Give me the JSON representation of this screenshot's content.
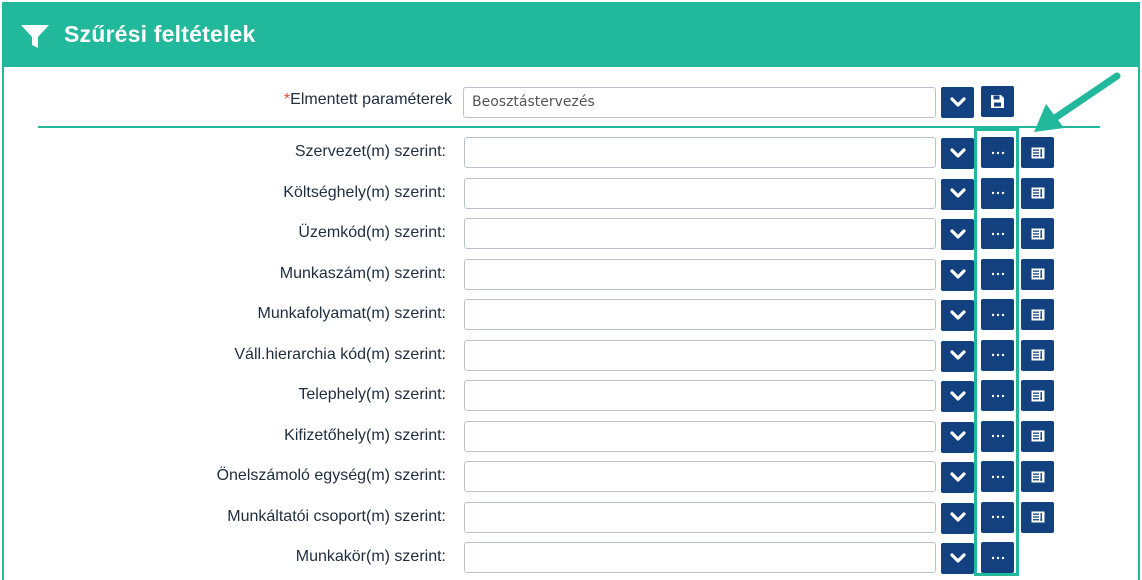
{
  "header": {
    "title": "Szűrési feltételek",
    "icon": "filter-icon"
  },
  "saved": {
    "required_mark": "*",
    "label": "Elmentett paraméterek",
    "value": "Beosztástervezés"
  },
  "rows": [
    {
      "label": "Szervezet(m) szerint:"
    },
    {
      "label": "Költséghely(m) szerint:"
    },
    {
      "label": "Üzemkód(m) szerint:"
    },
    {
      "label": "Munkaszám(m) szerint:"
    },
    {
      "label": "Munkafolyamat(m) szerint:"
    },
    {
      "label": "Váll.hierarchia kód(m) szerint:"
    },
    {
      "label": "Telephely(m) szerint:"
    },
    {
      "label": "Kifizetőhely(m) szerint:"
    },
    {
      "label": "Önelszámoló egység(m) szerint:"
    },
    {
      "label": "Munkáltatói csoport(m) szerint:"
    },
    {
      "label": "Munkakör(m) szerint:"
    }
  ],
  "colors": {
    "accent": "#22b89b",
    "button": "#13407e",
    "required": "#e0502c"
  }
}
